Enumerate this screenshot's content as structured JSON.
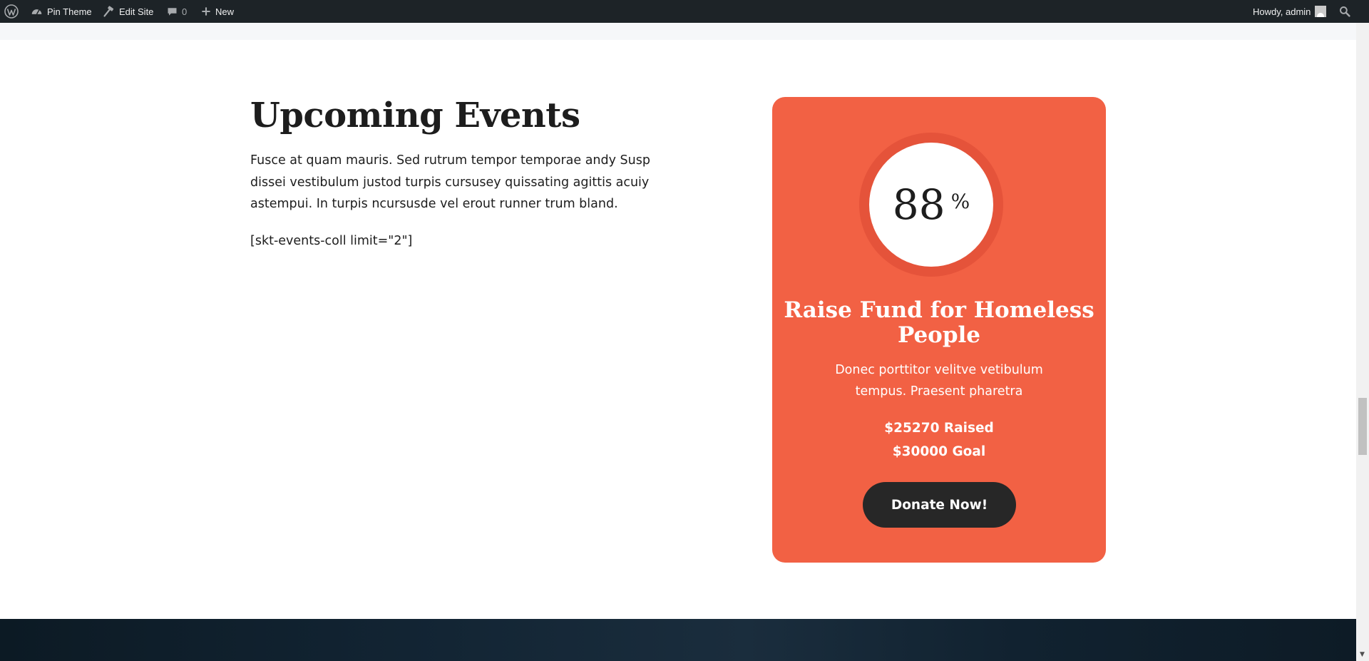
{
  "adminbar": {
    "site_name": "Pin Theme",
    "edit_site": "Edit Site",
    "comments_count": "0",
    "new_label": "New",
    "howdy": "Howdy, admin"
  },
  "events": {
    "title": "Upcoming Events",
    "description": "Fusce at quam mauris. Sed rutrum tempor temporae andy Susp dissei vestibulum justod turpis cursusey quissating agittis acuiy astempui. In turpis ncursusde vel erout runner trum bland.",
    "shortcode": "[skt-events-coll limit=\"2\"]"
  },
  "fundraiser": {
    "percent": "88",
    "percent_sign": "%",
    "title": "Raise Fund for Homeless People",
    "description": "Donec porttitor velitve vetibulum tempus. Praesent pharetra",
    "raised": "$25270 Raised",
    "goal": "$30000 Goal",
    "button_label": "Donate Now!",
    "card_color": "#f26144",
    "ring_color": "#e5533a",
    "button_color": "#272727"
  },
  "icons": {
    "wp_logo": "wordpress-icon",
    "site": "dashboard-icon",
    "edit": "hammer-icon",
    "comments": "comment-bubble-icon",
    "new": "plus-icon",
    "search": "search-icon",
    "avatar": "avatar-icon"
  }
}
